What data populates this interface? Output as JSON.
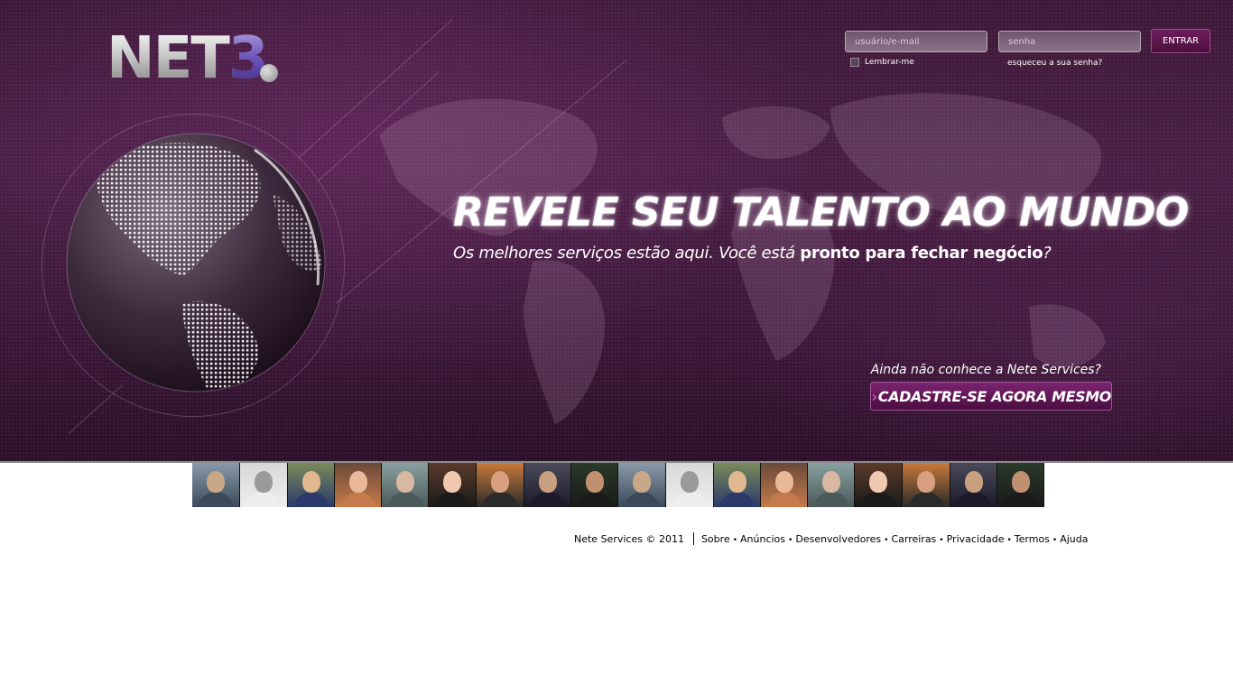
{
  "brand": {
    "logo_text": "NET",
    "logo_accent": "3",
    "accent_color": "#6a52b8"
  },
  "login": {
    "username_placeholder": "usuário/e-mail",
    "password_placeholder": "senha",
    "enter_label": "ENTRAR",
    "remember_label": "Lembrar-me",
    "forgot_label": "esqueceu a sua senha?"
  },
  "hero": {
    "headline": "REVELE SEU TALENTO AO MUNDO",
    "sub_part1": "Os melhores serviços estão aqui. Você está ",
    "sub_part2": "pronto para fechar negócio",
    "sub_part3": "?",
    "cta_question": "Ainda não conhece a Nete Services?",
    "cta_label": "CADASTRE-SE AGORA MESMO",
    "cta_icon": "chevron-right-icon",
    "background_color": "#3d1838"
  },
  "photos": [
    {
      "name": "photo-1"
    },
    {
      "name": "photo-2"
    },
    {
      "name": "photo-3"
    },
    {
      "name": "photo-4"
    },
    {
      "name": "photo-5"
    },
    {
      "name": "photo-6"
    },
    {
      "name": "photo-7"
    },
    {
      "name": "photo-8"
    },
    {
      "name": "photo-9"
    },
    {
      "name": "photo-10"
    },
    {
      "name": "photo-11"
    },
    {
      "name": "photo-12"
    },
    {
      "name": "photo-13"
    },
    {
      "name": "photo-14"
    },
    {
      "name": "photo-15"
    },
    {
      "name": "photo-16"
    },
    {
      "name": "photo-17"
    },
    {
      "name": "photo-18"
    }
  ],
  "footer": {
    "copyright": "Nete Services © 2011",
    "links": [
      "Sobre",
      "Anúncios",
      "Desenvolvedores",
      "Carreiras",
      "Privacidade",
      "Termos",
      "Ajuda"
    ]
  }
}
